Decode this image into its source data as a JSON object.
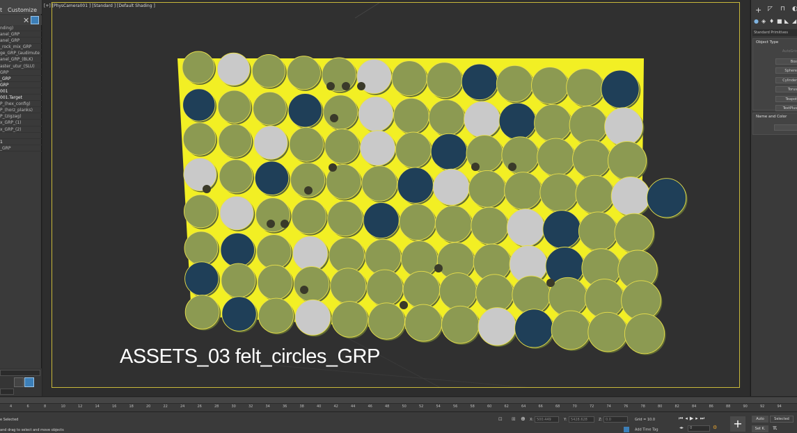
{
  "menubar": {
    "item1": "t",
    "item2": "Customize"
  },
  "explorer": {
    "rows": [
      "nding)",
      "anel_GRP",
      "anel_GRP",
      "_rock_mix_GRP",
      "ge_GRP_(audimute",
      "anel_GRP_(BLK)",
      "aster_utur_(SLU)",
      "GRP",
      "_GRP",
      "GRP",
      "001",
      "001.Target",
      "P_(hex_config)",
      "P_(horz_planks)",
      "P_(zigzag)",
      "x_GRP_(1)",
      "x_GRP_(2)",
      "",
      "1",
      "_GRP"
    ]
  },
  "viewport": {
    "label": "[+] [PhysCamera001 ] [Standard ] [Default Shading ]",
    "overlay_title": "ASSETS_03   felt_circles_GRP",
    "colors": {
      "olive": "#8c9a52",
      "navy": "#1f3f58",
      "gray": "#c9c9c9",
      "yellow_backing": "#f2ef24",
      "selection": "#e9e04a"
    }
  },
  "command_panel": {
    "category": "Standard Primitives",
    "object_type_title": "Object Type",
    "primitives": [
      "AutoGrid",
      "Box",
      "Sphere",
      "Cylinder",
      "Torus",
      "Teapot",
      "TextPlus"
    ],
    "name_color_title": "Name and Color"
  },
  "timeline": {
    "ticks": [
      "4",
      "6",
      "8",
      "10",
      "12",
      "14",
      "16",
      "18",
      "20",
      "22",
      "24",
      "26",
      "28",
      "30",
      "32",
      "34",
      "36",
      "38",
      "40",
      "42",
      "44",
      "46",
      "48",
      "50",
      "52",
      "54",
      "56",
      "58",
      "60",
      "62",
      "64",
      "66",
      "68",
      "70",
      "72",
      "74",
      "76",
      "78",
      "80",
      "82",
      "84",
      "86",
      "88",
      "90",
      "92",
      "94"
    ]
  },
  "status": {
    "line1": "e Selected",
    "line2": "and drag to select and move objects",
    "x_label": "X:",
    "x_value": "500.449",
    "y_label": "Y:",
    "y_value": "5428.628",
    "z_label": "Z:",
    "z_value": "0.0",
    "grid": "Grid = 10.0",
    "add_time_tag": "Add Time Tag",
    "frame": "0",
    "auto_key": "Auto",
    "selected": "Selected",
    "set_key": "Set K."
  }
}
